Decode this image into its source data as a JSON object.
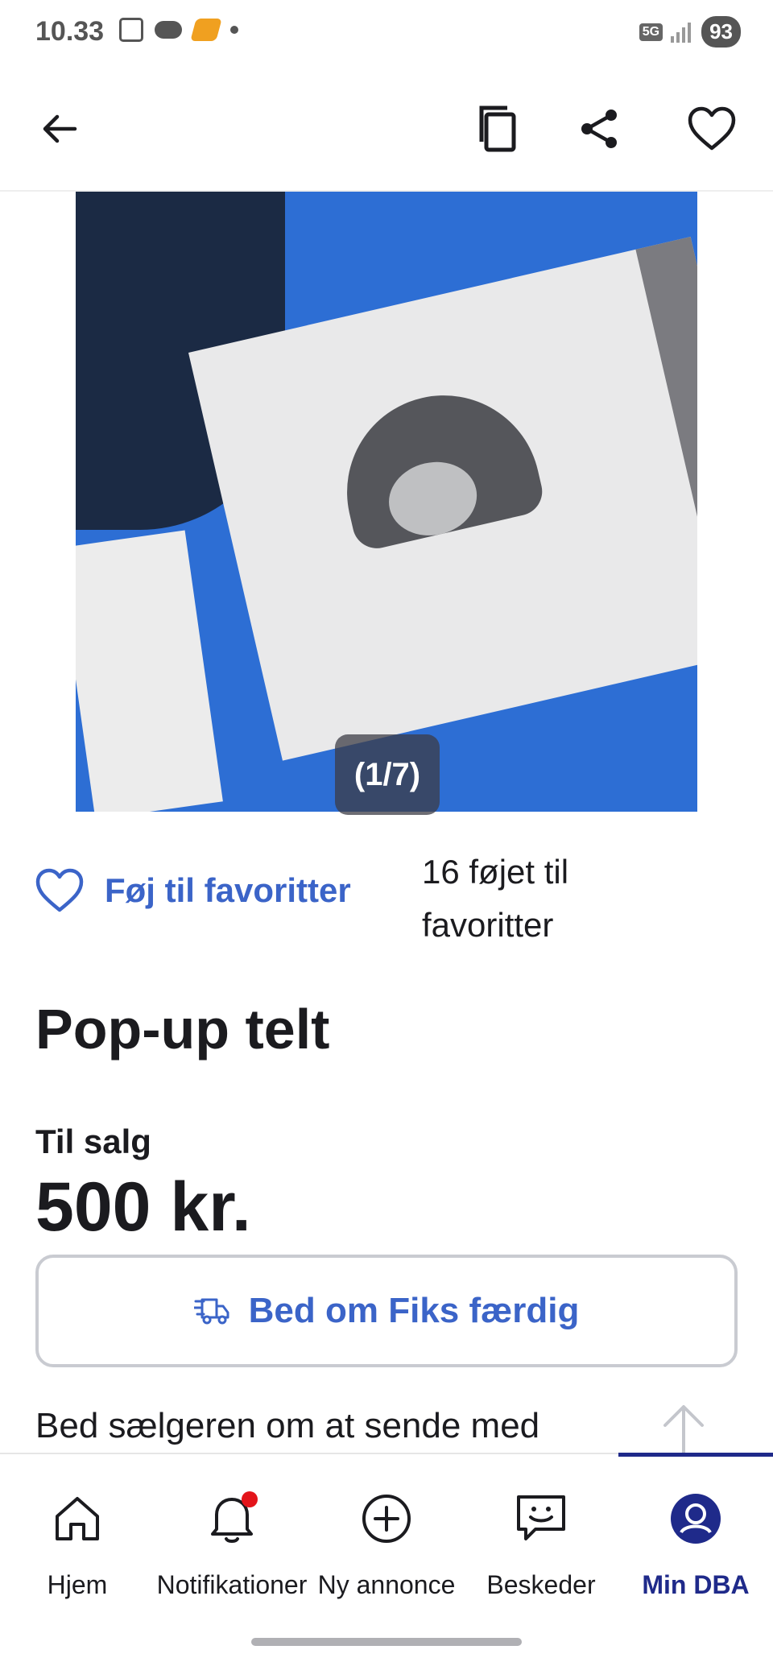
{
  "status_bar": {
    "time": "10.33",
    "network": "5G",
    "battery": "93"
  },
  "app_bar": {
    "back_icon": "arrow-left-icon",
    "copy_icon": "copy-icon",
    "share_icon": "share-icon",
    "favorite_icon": "heart-outline-icon"
  },
  "gallery": {
    "counter": "(1/7)"
  },
  "favorite": {
    "add_label": "Føj til favoritter",
    "count_text": "16 føjet til favoritter"
  },
  "listing": {
    "title": "Pop-up telt",
    "type_label": "Til salg",
    "price": "500 kr."
  },
  "fiks": {
    "button_label": "Bed om Fiks færdig"
  },
  "shipping": {
    "text": "Bed sælgeren om at sende med"
  },
  "bottom_nav": {
    "items": [
      {
        "label": "Hjem",
        "icon": "home-icon"
      },
      {
        "label": "Notifikationer",
        "icon": "bell-icon"
      },
      {
        "label": "Ny annonce",
        "icon": "plus-circle-icon"
      },
      {
        "label": "Beskeder",
        "icon": "chat-icon"
      },
      {
        "label": "Min DBA",
        "icon": "profile-icon"
      }
    ],
    "active_index": 4
  },
  "colors": {
    "accent": "#3b64c8",
    "nav_active": "#1f2a8a",
    "notification": "#e3141a"
  }
}
